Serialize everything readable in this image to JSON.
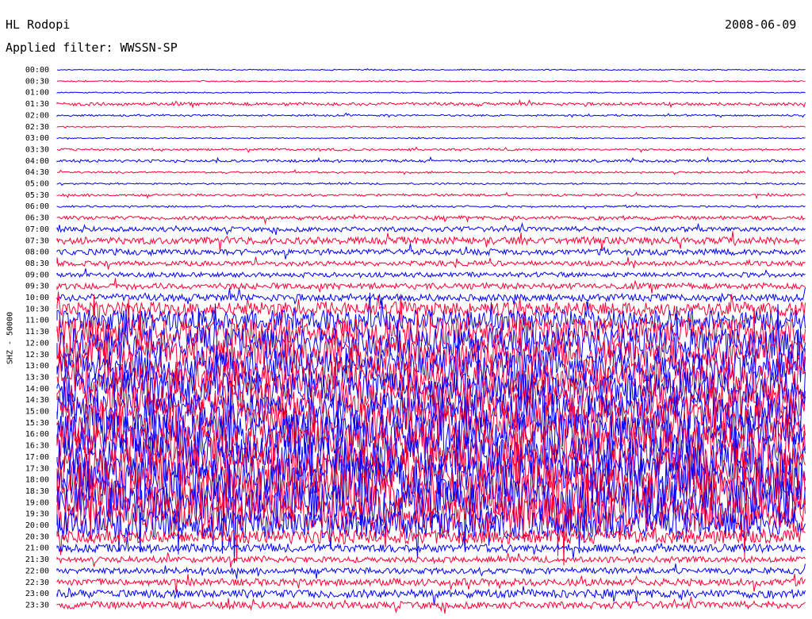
{
  "header": {
    "station": "HL Rodopi",
    "filter": "Applied filter: WWSSN-SP",
    "date": "2008-06-09"
  },
  "chart_data": {
    "type": "line",
    "title": "HL Rodopi",
    "ylabel": "SHZ - 50000",
    "tick_labels": [
      "00:00",
      "00:30",
      "01:00",
      "01:30",
      "02:00",
      "02:30",
      "03:00",
      "03:30",
      "04:00",
      "04:30",
      "05:00",
      "05:30",
      "06:00",
      "06:30",
      "07:00",
      "07:30",
      "08:00",
      "08:30",
      "09:00",
      "09:30",
      "10:00",
      "10:30",
      "11:00",
      "11:30",
      "12:00",
      "12:30",
      "13:00",
      "13:30",
      "14:00",
      "14:30",
      "15:00",
      "15:30",
      "16:00",
      "16:30",
      "17:00",
      "17:30",
      "18:00",
      "18:30",
      "19:00",
      "19:30",
      "20:00",
      "20:30",
      "21:00",
      "21:30",
      "22:00",
      "22:30",
      "23:00",
      "23:30"
    ],
    "trace_colors": [
      "#0000ff",
      "#ff0033"
    ],
    "relative_amplitude": [
      0.02,
      0.03,
      0.02,
      0.12,
      0.06,
      0.03,
      0.02,
      0.08,
      0.1,
      0.06,
      0.05,
      0.08,
      0.06,
      0.15,
      0.2,
      0.3,
      0.25,
      0.2,
      0.2,
      0.25,
      0.3,
      0.6,
      0.9,
      1.2,
      1.4,
      1.4,
      1.4,
      1.5,
      1.5,
      1.5,
      1.6,
      1.8,
      1.8,
      1.8,
      1.8,
      1.9,
      2.0,
      2.0,
      1.9,
      1.6,
      1.2,
      0.6,
      0.35,
      0.25,
      0.25,
      0.3,
      0.35,
      0.3
    ],
    "grid": false
  }
}
